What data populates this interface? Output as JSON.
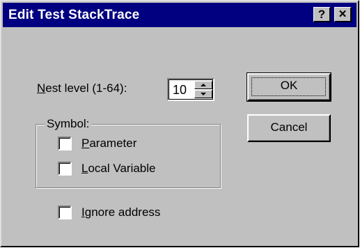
{
  "dialog": {
    "title": "Edit Test StackTrace",
    "help_label": "?",
    "close_label": "×"
  },
  "nest_level": {
    "label_mnemonic": "N",
    "label_rest": "est level (1-64):",
    "value": "10"
  },
  "symbol_group": {
    "legend": "Symbol:",
    "parameter": {
      "mnemonic": "P",
      "rest": "arameter",
      "checked": false
    },
    "local_variable": {
      "mnemonic": "L",
      "rest": "ocal Variable",
      "checked": false
    }
  },
  "ignore_address": {
    "mnemonic": "I",
    "rest": "gnore address",
    "checked": false
  },
  "buttons": {
    "ok": "OK",
    "cancel": "Cancel"
  },
  "colors": {
    "titlebar": "#000080",
    "face": "#c0c0c0"
  }
}
